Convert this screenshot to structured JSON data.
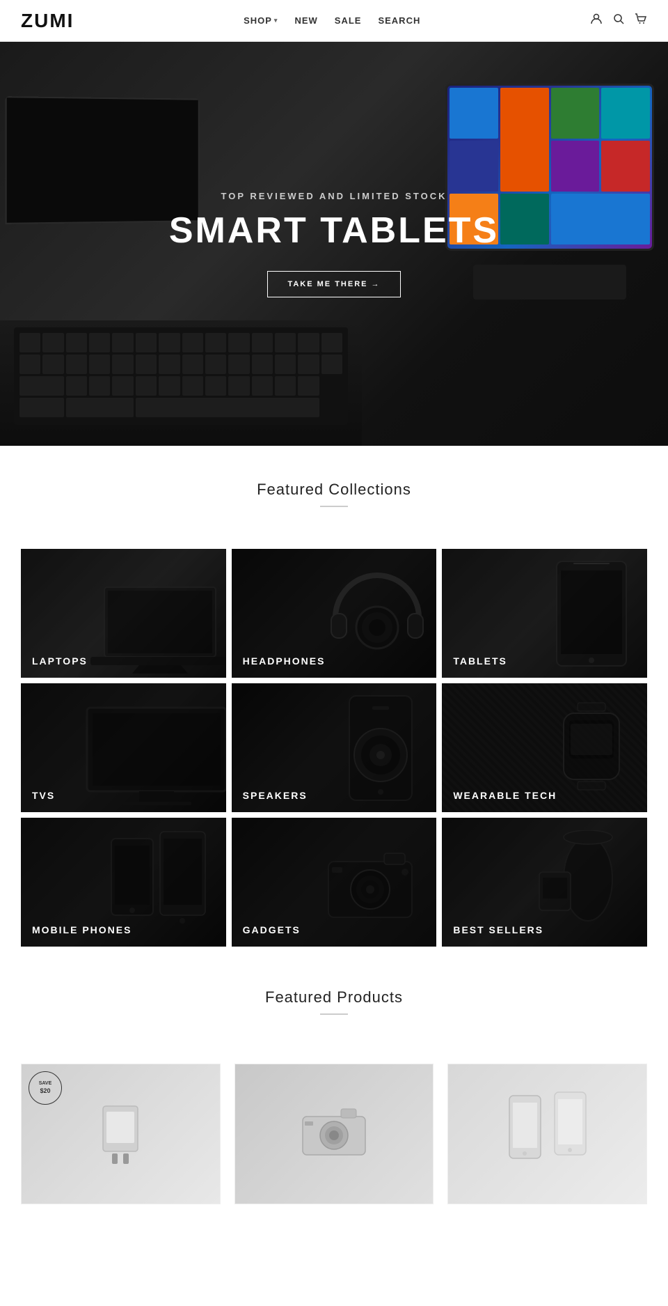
{
  "header": {
    "logo": "ZUMI",
    "nav": [
      {
        "label": "SHOP",
        "has_dropdown": true
      },
      {
        "label": "NEW",
        "has_dropdown": false
      },
      {
        "label": "SALE",
        "has_dropdown": false
      },
      {
        "label": "SEARCH",
        "has_dropdown": false
      }
    ],
    "icons": [
      {
        "name": "account-icon",
        "symbol": "👤"
      },
      {
        "name": "search-icon",
        "symbol": "🔍"
      },
      {
        "name": "cart-icon",
        "symbol": "🛒"
      }
    ]
  },
  "hero": {
    "subtitle": "TOP REVIEWED AND LIMITED STOCK",
    "title": "SMART TABLETS",
    "cta_label": "TAKE ME THERE →"
  },
  "featured_collections": {
    "section_title": "Featured Collections",
    "items": [
      {
        "id": "laptops",
        "label": "LAPTOPS"
      },
      {
        "id": "headphones",
        "label": "HEADPHONES"
      },
      {
        "id": "tablets",
        "label": "TABLETS"
      },
      {
        "id": "tvs",
        "label": "TVs"
      },
      {
        "id": "speakers",
        "label": "SPEAKERS"
      },
      {
        "id": "wearable-tech",
        "label": "WEARABLE TECH"
      },
      {
        "id": "mobile-phones",
        "label": "MOBILE PHONES"
      },
      {
        "id": "gadgets",
        "label": "GADGETS"
      },
      {
        "id": "best-sellers",
        "label": "BEST SELLERS"
      }
    ]
  },
  "featured_products": {
    "section_title": "Featured Products",
    "badge": {
      "line1": "SAVE",
      "line2": "$20"
    }
  }
}
